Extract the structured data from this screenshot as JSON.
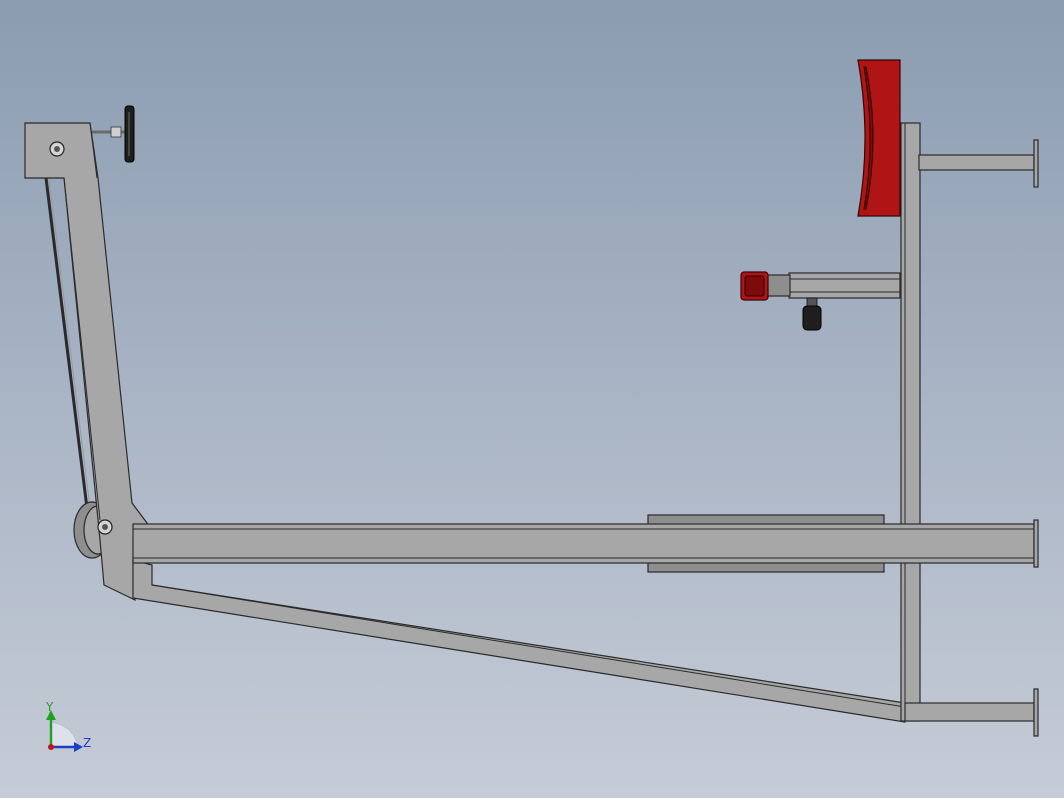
{
  "triad": {
    "y_label": "Y",
    "z_label": "Z",
    "y_color": "#1fa01f",
    "z_color": "#1d3fc4",
    "origin_color": "#c01818"
  },
  "colors": {
    "background_top": "#8b9cb1",
    "background_bottom": "#c6ccd7",
    "steel": "#a7a7a7",
    "edge": "#2a2a2a",
    "pad_red": "#b01515",
    "handle_black": "#1e1e1e"
  },
  "parts": [
    "pivot-arm",
    "cable",
    "pulley",
    "t-handle",
    "main-beam",
    "slider-sleeve",
    "diagonal-brace",
    "vertical-post",
    "top-foot",
    "bottom-foot",
    "back-pad",
    "side-arm",
    "side-pad",
    "knob"
  ]
}
